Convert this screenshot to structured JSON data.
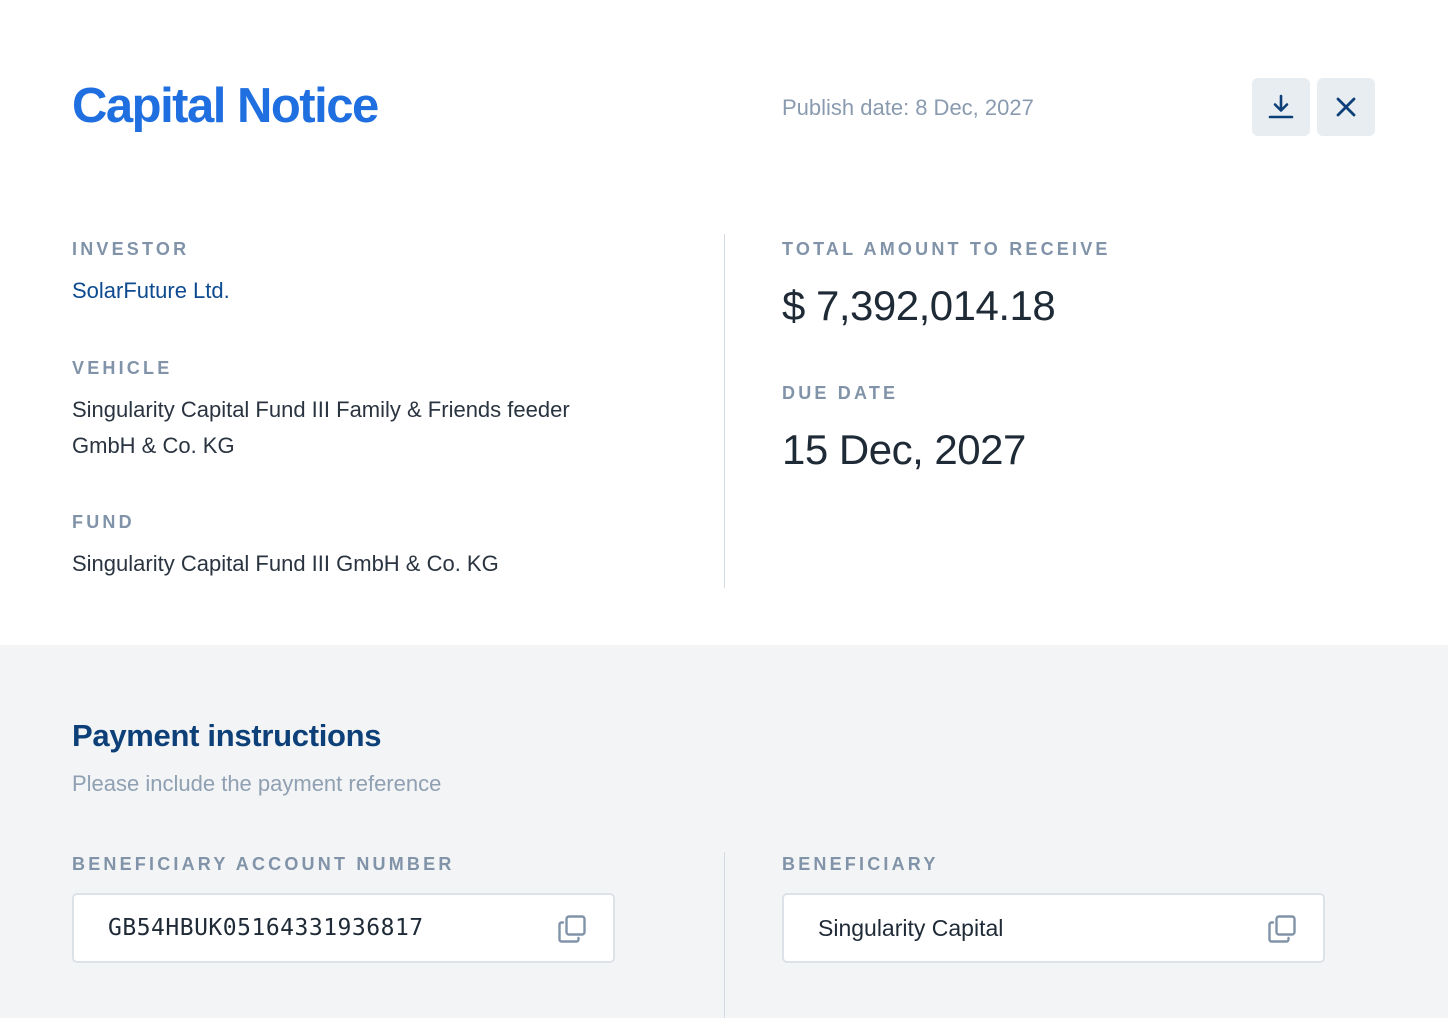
{
  "header": {
    "title": "Capital Notice",
    "publish_label": "Publish date:",
    "publish_date": "8 Dec, 2027",
    "download_icon": "download-icon",
    "close_icon": "close-icon"
  },
  "details": {
    "investor": {
      "label": "INVESTOR",
      "value": "SolarFuture Ltd."
    },
    "vehicle": {
      "label": "VEHICLE",
      "value": "Singularity Capital Fund III Family & Friends feeder GmbH & Co. KG"
    },
    "fund": {
      "label": "FUND",
      "value": "Singularity Capital Fund III GmbH & Co. KG"
    },
    "total": {
      "label": "TOTAL AMOUNT TO RECEIVE",
      "value": "$ 7,392,014.18"
    },
    "due_date": {
      "label": "DUE DATE",
      "value": "15 Dec, 2027"
    }
  },
  "payment": {
    "title": "Payment instructions",
    "subtitle": "Please include the payment reference",
    "account": {
      "label": "BENEFICIARY ACCOUNT NUMBER",
      "value": "GB54HBUK05164331936817",
      "copy_icon": "copy-icon"
    },
    "beneficiary": {
      "label": "BENEFICIARY",
      "value": "Singularity Capital",
      "copy_icon": "copy-icon"
    }
  },
  "colors": {
    "title": "#1f6fe0",
    "link": "#0d4a8f",
    "label": "#8193a8",
    "section_title": "#0d3f78",
    "payment_bg": "#f3f4f5",
    "icon": "#0d3f78"
  }
}
